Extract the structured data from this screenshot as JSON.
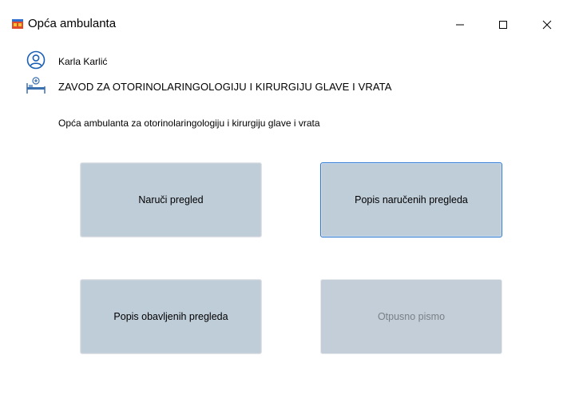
{
  "window": {
    "title": "Opća ambulanta",
    "controls": {
      "minimize": "—",
      "maximize": "☐",
      "close": "✕"
    }
  },
  "header": {
    "user_name": "Karla Karlić",
    "department": "ZAVOD ZA OTORINOLARINGOLOGIJU I KIRURGIJU GLAVE I VRATA",
    "user_icon": "user-circle-icon",
    "department_icon": "hospital-bed-icon"
  },
  "main": {
    "description": "Opća ambulanta za otorinolaringologiju i kirurgiju glave i vrata",
    "buttons": {
      "book_exam": "Naruči pregled",
      "booked_list": "Popis naručenih pregleda",
      "completed_list": "Popis obavljenih pregleda",
      "discharge_letter": "Otpusno pismo"
    }
  },
  "colors": {
    "tile_bg": "#bfcdd9",
    "focus_border": "#2f7ad0",
    "accent_blue": "#1a5fb4"
  }
}
